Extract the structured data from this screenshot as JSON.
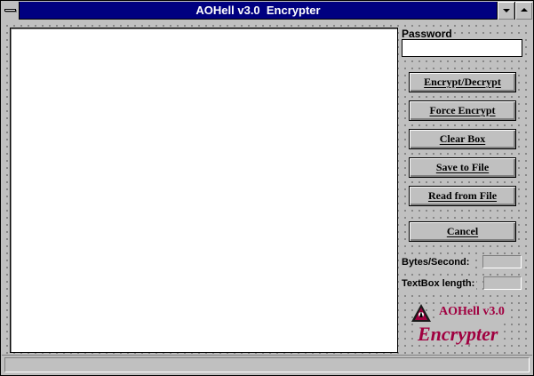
{
  "window": {
    "title": "AOHell v3.0  Encrypter"
  },
  "editor": {
    "text": ""
  },
  "password": {
    "label": "Password",
    "value": ""
  },
  "buttons": {
    "encrypt_decrypt": {
      "label": "Encrypt/Decrypt",
      "mnemonic": "E"
    },
    "force_encrypt": {
      "label": "Force Encrypt",
      "mnemonic": "F"
    },
    "clear_box": {
      "label": "Clear Box",
      "mnemonic": "B"
    },
    "save_to_file": {
      "label": "Save to File",
      "mnemonic": "S"
    },
    "read_from_file": {
      "label": "Read from File",
      "mnemonic": "R"
    },
    "cancel": {
      "label": "Cancel",
      "mnemonic": "C"
    }
  },
  "stats": {
    "bytes_per_second_label": "Bytes/Second:",
    "bytes_per_second_value": "",
    "textbox_length_label": "TextBox length:",
    "textbox_length_value": ""
  },
  "logo": {
    "name": "AOHell v3.0",
    "subtitle": "Encrypter",
    "icon": "aohell-triangle-logo-icon",
    "color": "#a00040"
  },
  "statusbar": {
    "text": ""
  },
  "colors": {
    "titlebar": "#000080",
    "face": "#c0c0c0"
  }
}
